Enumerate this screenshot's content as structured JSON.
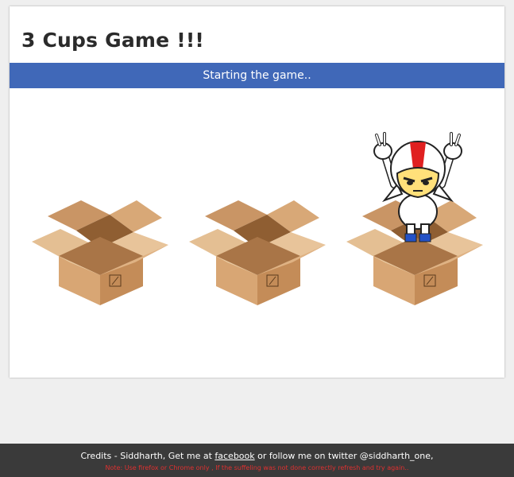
{
  "header": {
    "title": "3 Cups Game !!!"
  },
  "status": {
    "text": "Starting the game.."
  },
  "boxes": [
    {
      "label": "box-1"
    },
    {
      "label": "box-2"
    },
    {
      "label": "box-3"
    }
  ],
  "character": {
    "location": "box-3"
  },
  "footer": {
    "credits_prefix": "Credits - Siddharth, Get me at ",
    "facebook_link": "facebook",
    "credits_middle": " or follow me on twitter ",
    "twitter_handle": "@siddharth_one,",
    "note": "Note: Use firefox or Chrome only , If the suffeling was not done correctly refresh and try again.."
  },
  "colors": {
    "status_bar": "#4068b8",
    "footer_bg": "#3a3a3a",
    "note_text": "#e03030",
    "box_tan": "#d2a06e"
  }
}
